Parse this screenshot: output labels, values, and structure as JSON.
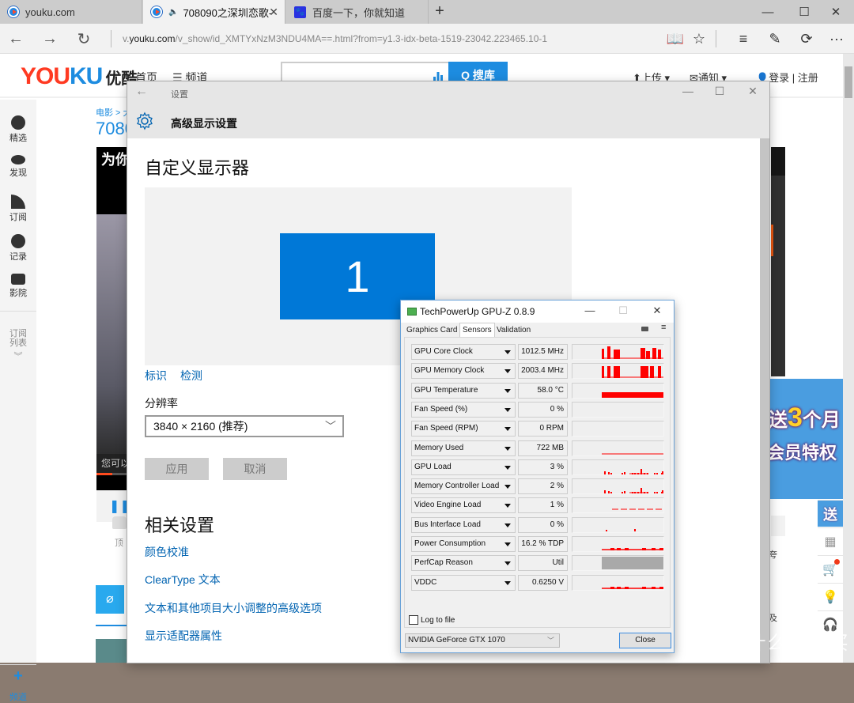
{
  "browser": {
    "tabs": [
      {
        "label": "youku.com",
        "icon": "youku-favicon-icon",
        "active": false
      },
      {
        "label": "708090之深圳恋歌-",
        "icon": "youku-favicon-icon",
        "audio": true,
        "active": true
      },
      {
        "label": "百度一下，你就知道",
        "icon": "baidu-favicon-icon",
        "active": false
      }
    ],
    "new_tab": "+",
    "window_buttons": {
      "minimize": "—",
      "maximize": "☐",
      "close": "✕"
    },
    "nav": {
      "back": "←",
      "forward": "→",
      "refresh": "↻"
    },
    "url_prefix": "v.",
    "url_domain": "youku.com",
    "url_path": "/v_show/id_XMTYxNzM3NDU4MA==.html?from=y1.3-idx-beta-1519-23042.223465.10-1",
    "toolbar": {
      "reading": "📖",
      "favorite": "☆",
      "hub": "≡",
      "note": "✎",
      "share": "⟳",
      "more": "···"
    }
  },
  "youku": {
    "logo_you": "YOU",
    "logo_ku": "KU",
    "logo_cn": "优酷",
    "nav": {
      "home": "首页",
      "channels": "☰ 频道"
    },
    "search_button": "Q 搜库",
    "upload": "⬆上传 ▾",
    "notify": "✉通知 ▾",
    "login": "👤登录 | 注册",
    "sidebar": [
      {
        "label": "精选",
        "icon": "play-circle-icon"
      },
      {
        "label": "发现",
        "icon": "eye-icon"
      },
      {
        "label": "订阅",
        "icon": "rss-icon"
      },
      {
        "label": "记录",
        "icon": "clock-icon"
      },
      {
        "label": "影院",
        "icon": "crown-icon"
      }
    ],
    "subscribe_list": "订阅\n列表",
    "subscribe_chev": "︾",
    "add_channel_icon": "+",
    "add_channel": "频道",
    "breadcrumb": "电影 > 大",
    "video_title": "7080",
    "video_overlay_top": "为你",
    "video_overlay_bottom": "您可以",
    "pause_icon": "❚❚",
    "like_label": "顶",
    "ad_line1_a": "送",
    "ad_line1_num": "3",
    "ad_line1_b": "个月",
    "ad_line2": "会员特权",
    "right_tools": [
      "送",
      "▦",
      "🛒",
      "💡",
      "🎧"
    ],
    "partial_text_1": "夸",
    "partial_text_2": "及",
    "watermark": "值 什么值得买"
  },
  "settings": {
    "back": "←",
    "app_title": "设置",
    "window_buttons": {
      "minimize": "—",
      "maximize": "☐",
      "close": "✕"
    },
    "page_title": "高级显示设置",
    "heading": "自定义显示器",
    "monitor_number": "1",
    "identify": "标识",
    "detect": "检测",
    "resolution_label": "分辨率",
    "resolution_value": "3840 × 2160 (推荐)",
    "apply": "应用",
    "cancel": "取消",
    "related_heading": "相关设置",
    "related_links": [
      "颜色校准",
      "ClearType 文本",
      "文本和其他项目大小调整的高级选项",
      "显示适配器属性"
    ]
  },
  "gpuz": {
    "title": "TechPowerUp GPU-Z 0.8.9",
    "window_buttons": {
      "minimize": "—",
      "maximize": "☐",
      "close": "✕"
    },
    "tabs": [
      "Graphics Card",
      "Sensors",
      "Validation"
    ],
    "active_tab": "Sensors",
    "sensors": [
      {
        "name": "GPU Core Clock",
        "value": "1012.5 MHz",
        "graph": "clock"
      },
      {
        "name": "GPU Memory Clock",
        "value": "2003.4 MHz",
        "graph": "clock2"
      },
      {
        "name": "GPU Temperature",
        "value": "58.0 °C",
        "graph": "temp"
      },
      {
        "name": "Fan Speed (%)",
        "value": "0 %",
        "graph": "none"
      },
      {
        "name": "Fan Speed (RPM)",
        "value": "0 RPM",
        "graph": "none"
      },
      {
        "name": "Memory Used",
        "value": "722 MB",
        "graph": "flat"
      },
      {
        "name": "GPU Load",
        "value": "3 %",
        "graph": "spiky"
      },
      {
        "name": "Memory Controller Load",
        "value": "2 %",
        "graph": "spiky"
      },
      {
        "name": "Video Engine Load",
        "value": "1 %",
        "graph": "dashed"
      },
      {
        "name": "Bus Interface Load",
        "value": "0 %",
        "graph": "dots"
      },
      {
        "name": "Power Consumption",
        "value": "16.2 % TDP",
        "graph": "low"
      },
      {
        "name": "PerfCap Reason",
        "value": "Util",
        "graph": "gray"
      },
      {
        "name": "VDDC",
        "value": "0.6250 V",
        "graph": "low"
      }
    ],
    "log_to_file": "Log to file",
    "card": "NVIDIA GeForce GTX 1070",
    "close": "Close",
    "graph_color": "#ff0000"
  }
}
